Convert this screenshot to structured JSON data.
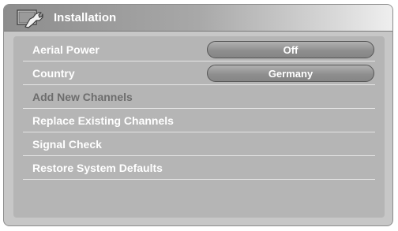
{
  "header": {
    "title": "Installation",
    "icon": "settings-wrench-icon"
  },
  "menu": {
    "items": [
      {
        "label": "Aerial Power",
        "value": "Off"
      },
      {
        "label": "Country",
        "value": "Germany"
      },
      {
        "label": "Add New Channels"
      },
      {
        "label": "Replace Existing Channels"
      },
      {
        "label": "Signal Check"
      },
      {
        "label": "Restore System Defaults"
      }
    ]
  },
  "colors": {
    "title_gradient_start": "#8d8d8d",
    "panel_background": "#b5b5b5",
    "text_primary": "#ffffff",
    "text_disabled": "#6d6d6d"
  }
}
